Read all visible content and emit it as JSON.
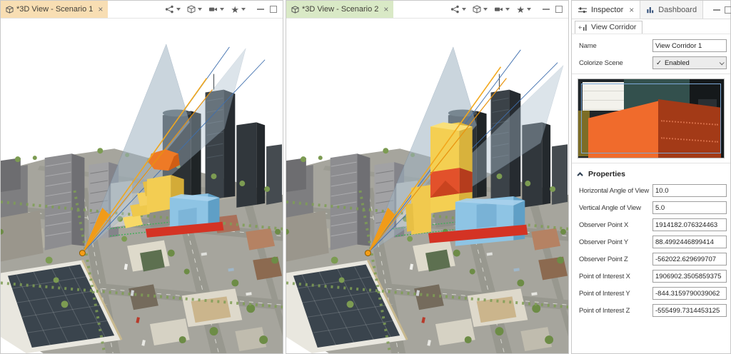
{
  "tabs": {
    "scenario1": {
      "title": "*3D View - Scenario 1"
    },
    "scenario2": {
      "title": "*3D View - Scenario 2"
    }
  },
  "icons": {
    "star": "★",
    "check": "✓",
    "close": "×"
  },
  "inspector": {
    "tab_inspector": "Inspector",
    "tab_dashboard": "Dashboard",
    "subtab": "View Corridor",
    "name_label": "Name",
    "name_value": "View Corridor 1",
    "colorize_label": "Colorize Scene",
    "colorize_value": "Enabled",
    "properties_header": "Properties",
    "rows": [
      {
        "label": "Horizontal Angle of View",
        "value": "10.0"
      },
      {
        "label": "Vertical Angle of View",
        "value": "5.0"
      },
      {
        "label": "Observer Point X",
        "value": "1914182.076324463"
      },
      {
        "label": "Observer Point Y",
        "value": "88.4992446899414"
      },
      {
        "label": "Observer Point Z",
        "value": "-562022.629699707"
      },
      {
        "label": "Point of Interest X",
        "value": "1906902.3505859375"
      },
      {
        "label": "Point of Interest Y",
        "value": "-844.3159790039062"
      },
      {
        "label": "Point of Interest Z",
        "value": "-555499.7314453125"
      }
    ]
  }
}
